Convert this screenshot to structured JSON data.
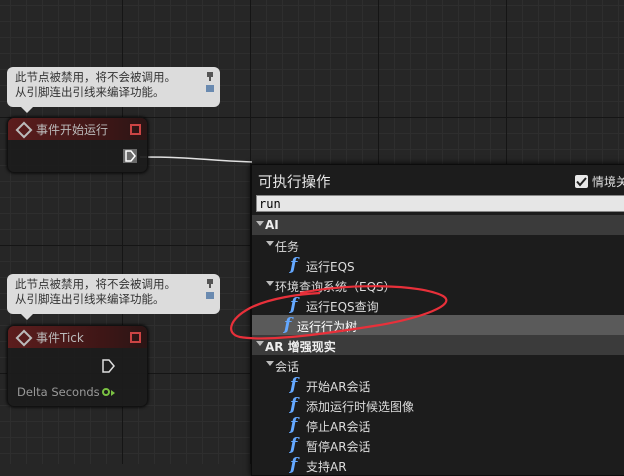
{
  "comment_text_1": "此节点被禁用，将不会被调用。",
  "comment_text_2": "从引脚连出引线来编译功能。",
  "node_begin_play": {
    "title": "事件开始运行"
  },
  "node_tick": {
    "title": "事件Tick",
    "pin_label": "Delta Seconds"
  },
  "menu": {
    "title": "可执行操作",
    "context_label": "情境关",
    "search_value": "run",
    "items": [
      {
        "kind": "category",
        "label": "AI"
      },
      {
        "kind": "sub",
        "label": "任务"
      },
      {
        "kind": "fn",
        "label": "运行EQS"
      },
      {
        "kind": "sub",
        "label": "环境查询系统（EQS）"
      },
      {
        "kind": "fn",
        "label": "运行EQS查询"
      },
      {
        "kind": "fn-selected",
        "label": "运行行为树"
      },
      {
        "kind": "category",
        "label": "AR 增强现实"
      },
      {
        "kind": "sub",
        "label": "会话"
      },
      {
        "kind": "fn",
        "label": "开始AR会话"
      },
      {
        "kind": "fn",
        "label": "添加运行时候选图像"
      },
      {
        "kind": "fn",
        "label": "停止AR会话"
      },
      {
        "kind": "fn",
        "label": "暂停AR会话"
      },
      {
        "kind": "fn",
        "label": "支持AR"
      }
    ]
  },
  "colors": {
    "function_icon": "#64a8ff",
    "annotation": "#e8303a",
    "event_header": "#5c1d1d",
    "float_pin": "#7ac142"
  }
}
